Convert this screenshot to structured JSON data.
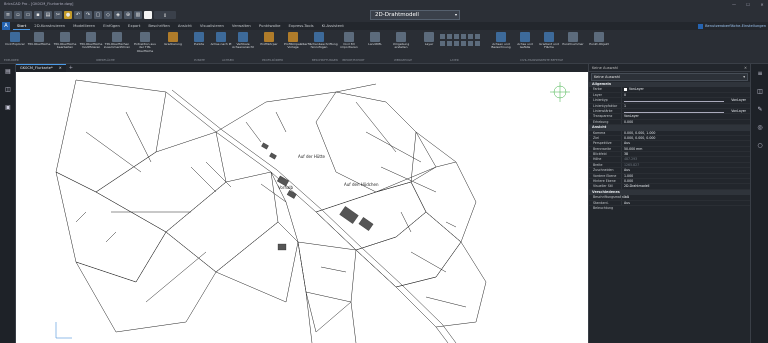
{
  "window": {
    "title": "BricsCAD Pro - [GK0CM_Flurkarte.dwg]",
    "controls": {
      "minimize": "—",
      "maximize": "☐",
      "close": "✕"
    }
  },
  "qat": {
    "workspace_value": "2D-Drahtmodell",
    "workspace_arrow": "▾",
    "color_value": "0"
  },
  "menu_tabs": [
    "Start",
    "2D-Konstruieren",
    "Modellieren",
    "Einfügen",
    "Export",
    "Beschriften",
    "Ansicht",
    "Visualisieren",
    "Verwalten",
    "Punktwolke",
    "Express-Tools",
    "KI-Assistent"
  ],
  "active_tab": "Start",
  "ui_settings_label": "Benutzeroberfläche-Einstellungen",
  "ribbon": {
    "buttons": [
      "Civil Explorer",
      "TIN-Oberfläche",
      "TIN-Oberfläche bearbeiten",
      "TIN-Oberfläche modifizieren",
      "TIN-Oberflächen zusammenführen",
      "Extraktion aus der TIN-Oberfläche",
      "Gradiierung",
      "Punkte",
      "Achse nach PI",
      "Vertikale Achsenansicht",
      "Profilkörper",
      "Profilkörper-Vorlage",
      "Oberflächenbeschriftung hinzufügen",
      "Civil 3D importieren",
      "LandXML",
      "Umgebung erstellen",
      "Layer",
      "Achsen und Bezeichnung",
      "Achse und Gefälle",
      "Gradient und Fläche",
      "Punktnummer",
      "Punkt-Objekt"
    ],
    "groups": [
      "EXPLORER",
      "OBERFLÄCHE",
      "PUNKTE",
      "ACHSEN",
      "PROFILKÖRPER",
      "BESCHRIFTUNGEN",
      "IMPORT/EXPORT",
      "WERKZEUGE",
      "LAYER",
      "CIVIL-TRANSPARENTE BEFEHLE"
    ]
  },
  "document_tab": {
    "name": "GK0CM_Flurkarte*",
    "close": "✕"
  },
  "canvas": {
    "labels": [
      "Auf der Hütte",
      "Auf den Hödchen",
      "Vorhalb"
    ]
  },
  "properties": {
    "header": "Keine Auswahl",
    "sections": [
      {
        "name": "Allgemein",
        "rows": [
          {
            "k": "Farbe",
            "v": "VonLayer"
          },
          {
            "k": "Layer",
            "v": "0"
          },
          {
            "k": "Linientyp",
            "v": "VonLayer"
          },
          {
            "k": "Linientypfaktor",
            "v": "1"
          },
          {
            "k": "Linienstärke",
            "v": "VonLayer"
          },
          {
            "k": "Transparenz",
            "v": "VonLayer"
          },
          {
            "k": "Erhebung",
            "v": "0.000"
          }
        ]
      },
      {
        "name": "Ansicht",
        "rows": [
          {
            "k": "Kamera",
            "v": "0.000, 0.000, 1.000"
          },
          {
            "k": "Ziel",
            "v": "0.000, 0.000, 0.000"
          },
          {
            "k": "Perspektive",
            "v": "Aus"
          },
          {
            "k": "Brennweite",
            "v": "50.000 mm"
          },
          {
            "k": "Blickfeld",
            "v": "38"
          },
          {
            "k": "Höhe",
            "v": "487.293"
          },
          {
            "k": "Breite",
            "v": "1265.827"
          },
          {
            "k": "Zuschneiden",
            "v": "Aus"
          },
          {
            "k": "Vordere Ebene",
            "v": "1.000"
          },
          {
            "k": "Hintere Ebene",
            "v": "0.000"
          },
          {
            "k": "Visueller Stil",
            "v": "2D-Drahtmodell"
          }
        ]
      },
      {
        "name": "Verschiedenes",
        "rows": [
          {
            "k": "Beschriftungsmaßstab",
            "v": "1:1"
          },
          {
            "k": "Standard-Beleuchtung",
            "v": "Aus"
          }
        ]
      }
    ]
  }
}
